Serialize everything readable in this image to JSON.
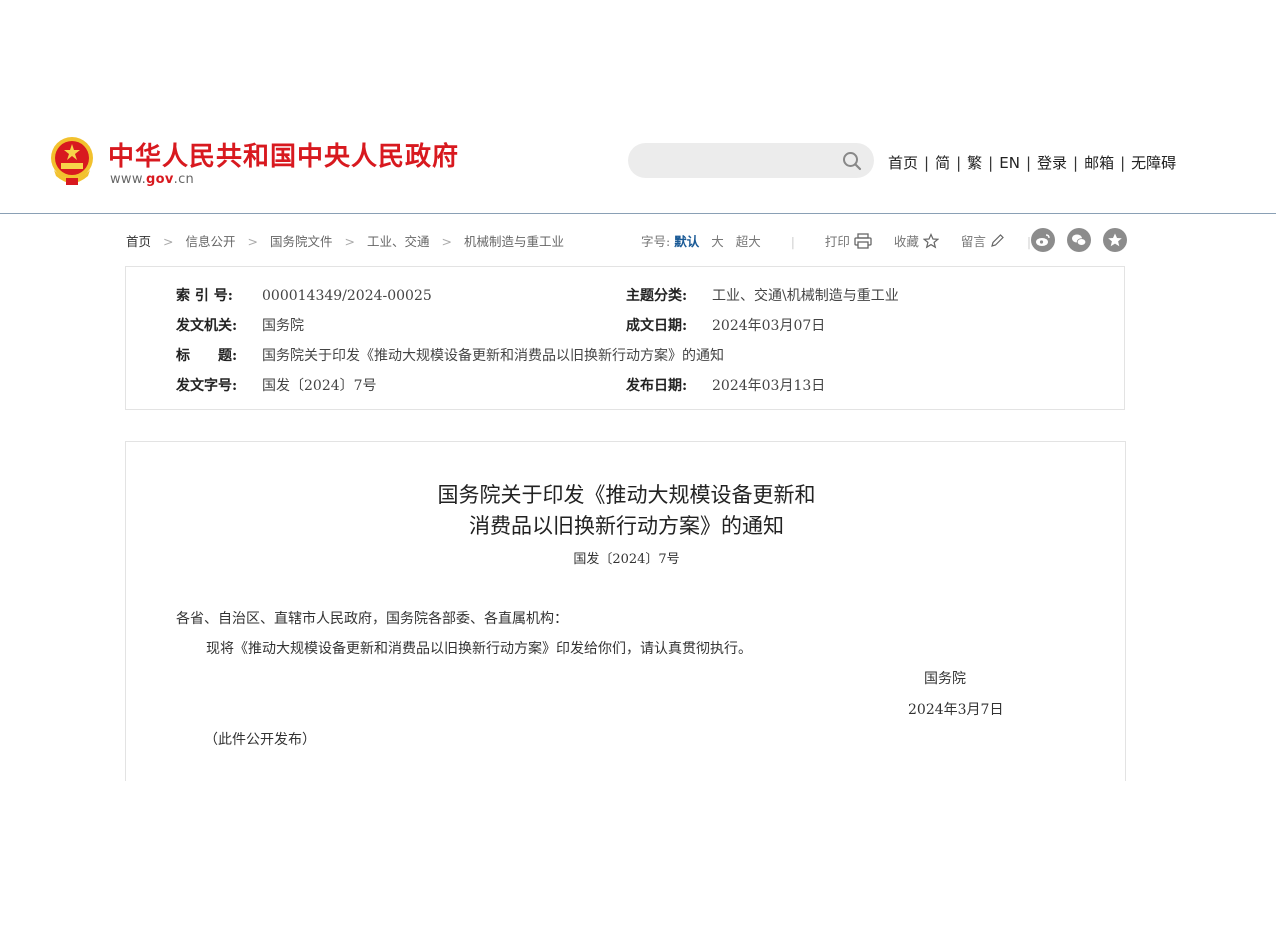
{
  "header": {
    "site_title": "中华人民共和国中央人民政府",
    "site_url_prefix": "www.",
    "site_url_domain": "gov",
    "site_url_suffix": ".cn",
    "search_placeholder": "",
    "nav": [
      "首页",
      "简",
      "繁",
      "EN",
      "登录",
      "邮箱",
      "无障碍"
    ],
    "nav_separator": "|"
  },
  "breadcrumb": {
    "items": [
      "首页",
      "信息公开",
      "国务院文件",
      "工业、交通",
      "机械制造与重工业"
    ],
    "separator": ">"
  },
  "toolbar": {
    "font_size_label": "字号:",
    "font_size_options": [
      "默认",
      "大",
      "超大"
    ],
    "font_size_selected": "默认",
    "print_label": "打印",
    "favorite_label": "收藏",
    "comment_label": "留言",
    "divider": "|",
    "share_icons": [
      "weibo-icon",
      "wechat-icon",
      "star-share-icon"
    ]
  },
  "meta": {
    "index_label": "索 引 号:",
    "index_value": "000014349/2024-00025",
    "topic_label": "主题分类:",
    "topic_value": "工业、交通\\机械制造与重工业",
    "issuer_label": "发文机关:",
    "issuer_value": "国务院",
    "written_date_label": "成文日期:",
    "written_date_value": "2024年03月07日",
    "title_label": "标　　题:",
    "title_value": "国务院关于印发《推动大规模设备更新和消费品以旧换新行动方案》的通知",
    "doc_no_label": "发文字号:",
    "doc_no_value": "国发〔2024〕7号",
    "publish_date_label": "发布日期:",
    "publish_date_value": "2024年03月13日"
  },
  "article": {
    "title_line1": "国务院关于印发《推动大规模设备更新和",
    "title_line2": "消费品以旧换新行动方案》的通知",
    "doc_no": "国发〔2024〕7号",
    "salutation": "各省、自治区、直辖市人民政府，国务院各部委、各直属机构：",
    "body": "现将《推动大规模设备更新和消费品以旧换新行动方案》印发给你们，请认真贯彻执行。",
    "signatory": "国务院",
    "sign_date": "2024年3月7日",
    "note": "（此件公开发布）"
  },
  "colors": {
    "brand_red": "#d8191f",
    "active_blue": "#1a5a96",
    "icon_gray": "#8c8c8c"
  }
}
